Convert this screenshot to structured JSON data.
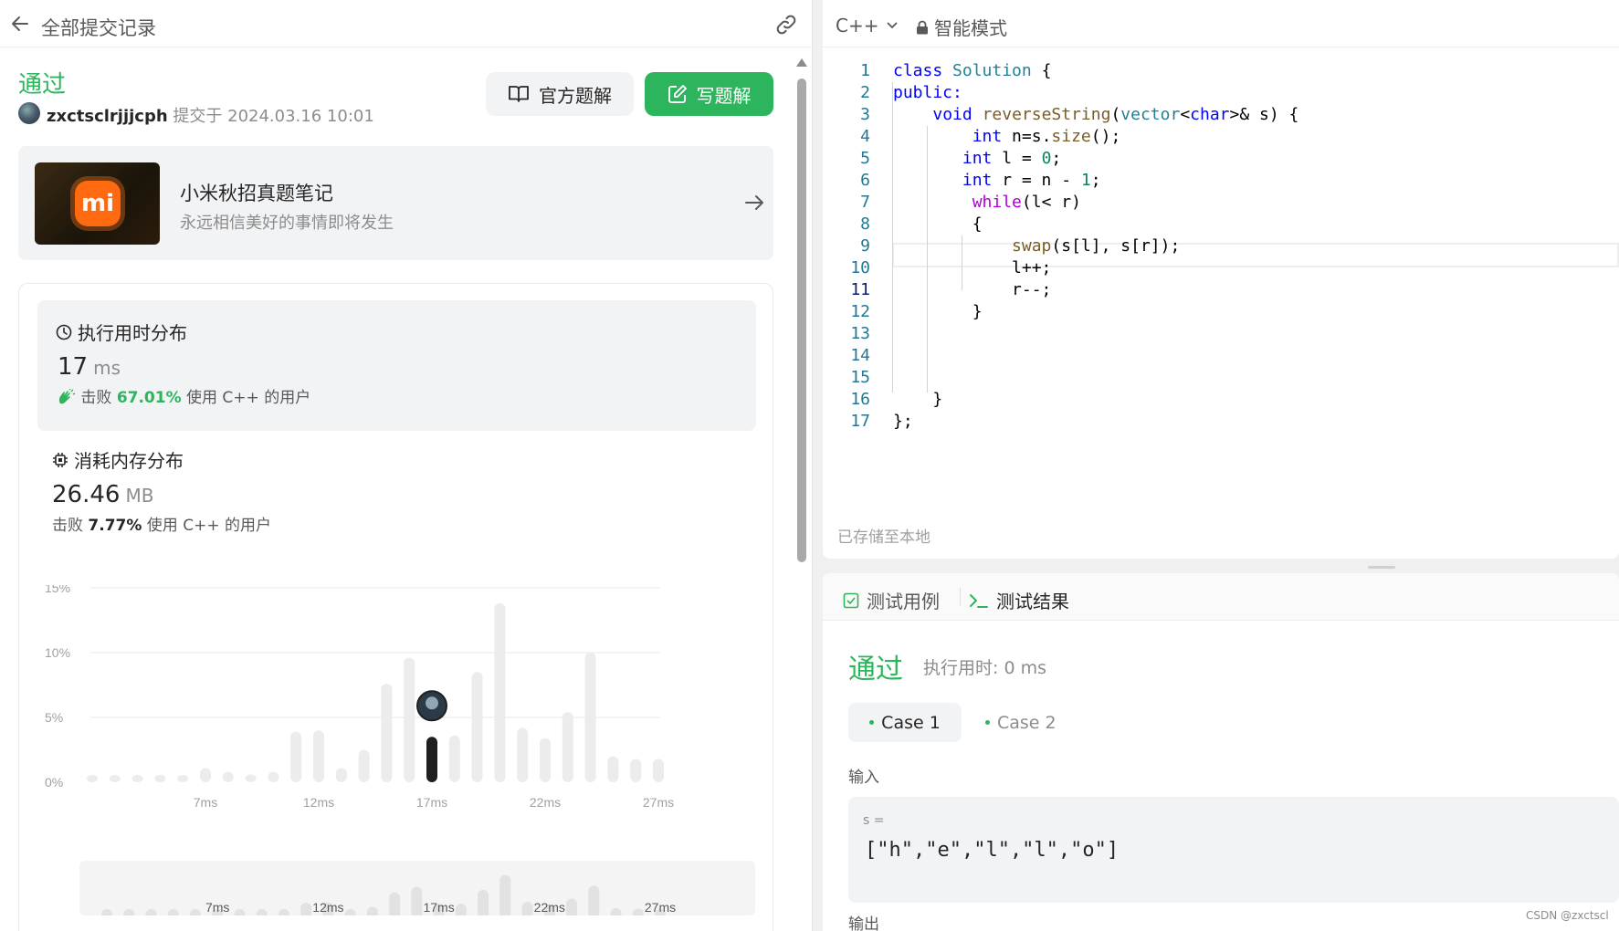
{
  "header": {
    "title": "全部提交记录"
  },
  "submission": {
    "status": "通过",
    "username": "zxctsclrjjjcph",
    "submitted_text": "提交于 2024.03.16 10:01",
    "official_button": "官方题解",
    "write_button": "写题解"
  },
  "note_card": {
    "title": "小米秋招真题笔记",
    "subtitle": "永远相信美好的事情即将发生",
    "logo_text": "mi"
  },
  "runtime": {
    "title": "执行用时分布",
    "value": "17",
    "unit": "ms",
    "beat_prefix": "击败",
    "beat_pct": "67.01%",
    "beat_suffix": "使用 C++ 的用户"
  },
  "memory": {
    "title": "消耗内存分布",
    "value": "26.46",
    "unit": "MB",
    "beat_prefix": "击败",
    "beat_pct": "7.77%",
    "beat_suffix": "使用 C++ 的用户"
  },
  "chart_data": {
    "type": "bar",
    "ylim": [
      0,
      15
    ],
    "yticks": [
      "15%",
      "10%",
      "5%",
      "0%"
    ],
    "ytick_values": [
      15,
      10,
      5,
      0
    ],
    "xtick_labels": [
      "7ms",
      "12ms",
      "17ms",
      "22ms",
      "27ms"
    ],
    "xtick_positions": [
      5,
      10,
      15,
      20,
      25
    ],
    "values": [
      0.4,
      0.4,
      0.4,
      0.4,
      0.4,
      1.1,
      0.8,
      0.6,
      0.8,
      3.9,
      4.0,
      1.1,
      2.5,
      7.6,
      9.6,
      3.5,
      3.6,
      8.5,
      13.8,
      4.2,
      3.4,
      5.4,
      10.0,
      2.0,
      1.8,
      1.8
    ],
    "x_start": 1,
    "highlight_index": 15,
    "grid": true,
    "colors": {
      "bar": "#ececec",
      "highlight": "#1f1f1f",
      "grid": "#e8e8e8",
      "tick": "#a0a0a0"
    }
  },
  "editor": {
    "language": "C++",
    "mode": "智能模式",
    "saved_text": "已存储至本地",
    "line_numbers": [
      "1",
      "2",
      "3",
      "4",
      "5",
      "6",
      "7",
      "8",
      "9",
      "10",
      "11",
      "12",
      "13",
      "14",
      "15",
      "16",
      "17"
    ]
  },
  "tests": {
    "tab_cases": "测试用例",
    "tab_result": "测试结果",
    "result_status": "通过",
    "result_time": "执行用时: 0 ms",
    "case1": "Case 1",
    "case2": "Case 2",
    "input_label": "输入",
    "input_var": "s =",
    "input_value": "[\"h\",\"e\",\"l\",\"l\",\"o\"]",
    "output_label": "输出"
  },
  "watermark": "CSDN @zxctscl"
}
